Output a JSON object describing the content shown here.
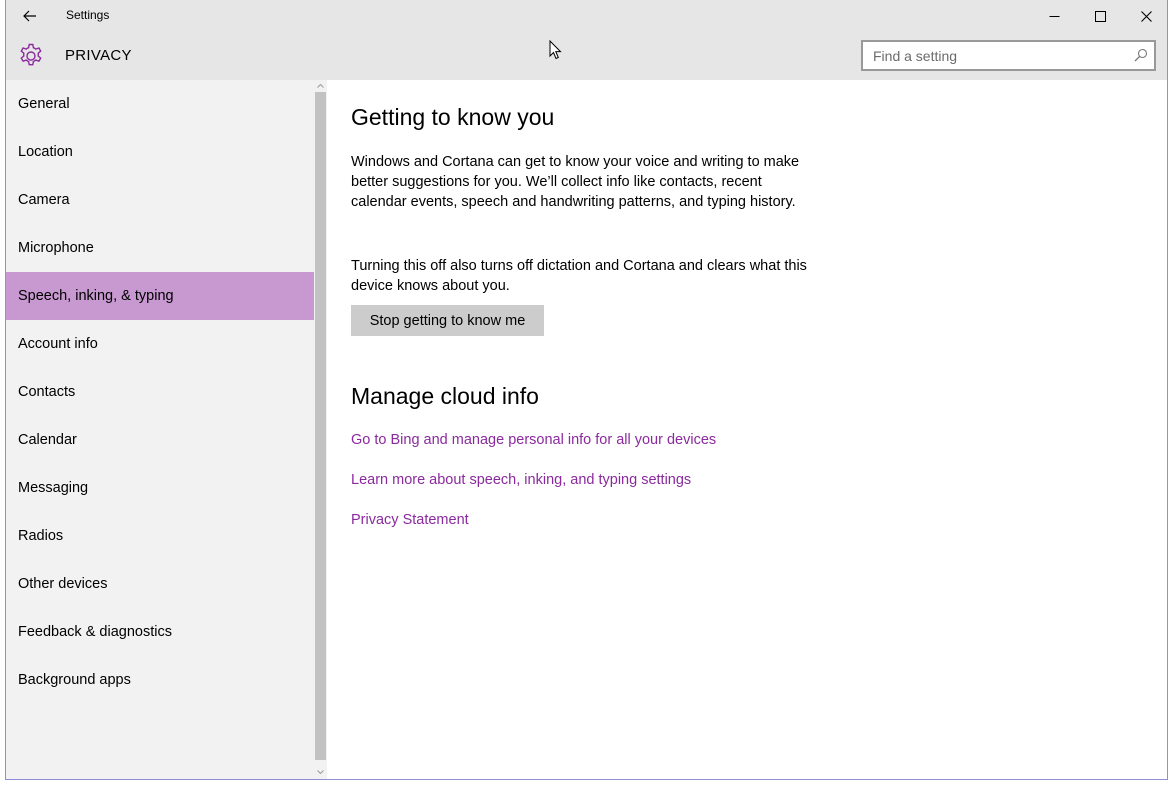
{
  "window": {
    "title": "Settings"
  },
  "header": {
    "section_title": "PRIVACY",
    "search_placeholder": "Find a setting"
  },
  "sidebar": {
    "items": [
      {
        "label": "General"
      },
      {
        "label": "Location"
      },
      {
        "label": "Camera"
      },
      {
        "label": "Microphone"
      },
      {
        "label": "Speech, inking, & typing",
        "active": true
      },
      {
        "label": "Account info"
      },
      {
        "label": "Contacts"
      },
      {
        "label": "Calendar"
      },
      {
        "label": "Messaging"
      },
      {
        "label": "Radios"
      },
      {
        "label": "Other devices"
      },
      {
        "label": "Feedback & diagnostics"
      },
      {
        "label": "Background apps"
      }
    ]
  },
  "main": {
    "section1_title": "Getting to know you",
    "section1_desc": "Windows and Cortana can get to know your voice and writing to make better suggestions for you. We’ll collect info like contacts, recent calendar events, speech and handwriting patterns, and typing history.",
    "section1_note": "Turning this off also turns off dictation and Cortana and clears what this device knows about you.",
    "stop_button_label": "Stop getting to know me",
    "section2_title": "Manage cloud info",
    "links": [
      {
        "label": "Go to Bing and manage personal info for all your devices"
      },
      {
        "label": "Learn more about speech, inking, and typing settings"
      },
      {
        "label": "Privacy Statement"
      }
    ]
  },
  "colors": {
    "accent": "#c898d0",
    "link": "#8b2a9e",
    "gear": "#8b2a9e",
    "titlebar": "#e6e6e6",
    "sidebar_bg": "#f2f2f2",
    "button_bg": "#cccccc"
  },
  "icons": {
    "back": "back-arrow-icon",
    "settings": "gear-icon",
    "search": "search-icon",
    "minimize": "minimize-icon",
    "maximize": "maximize-icon",
    "close": "close-icon"
  }
}
